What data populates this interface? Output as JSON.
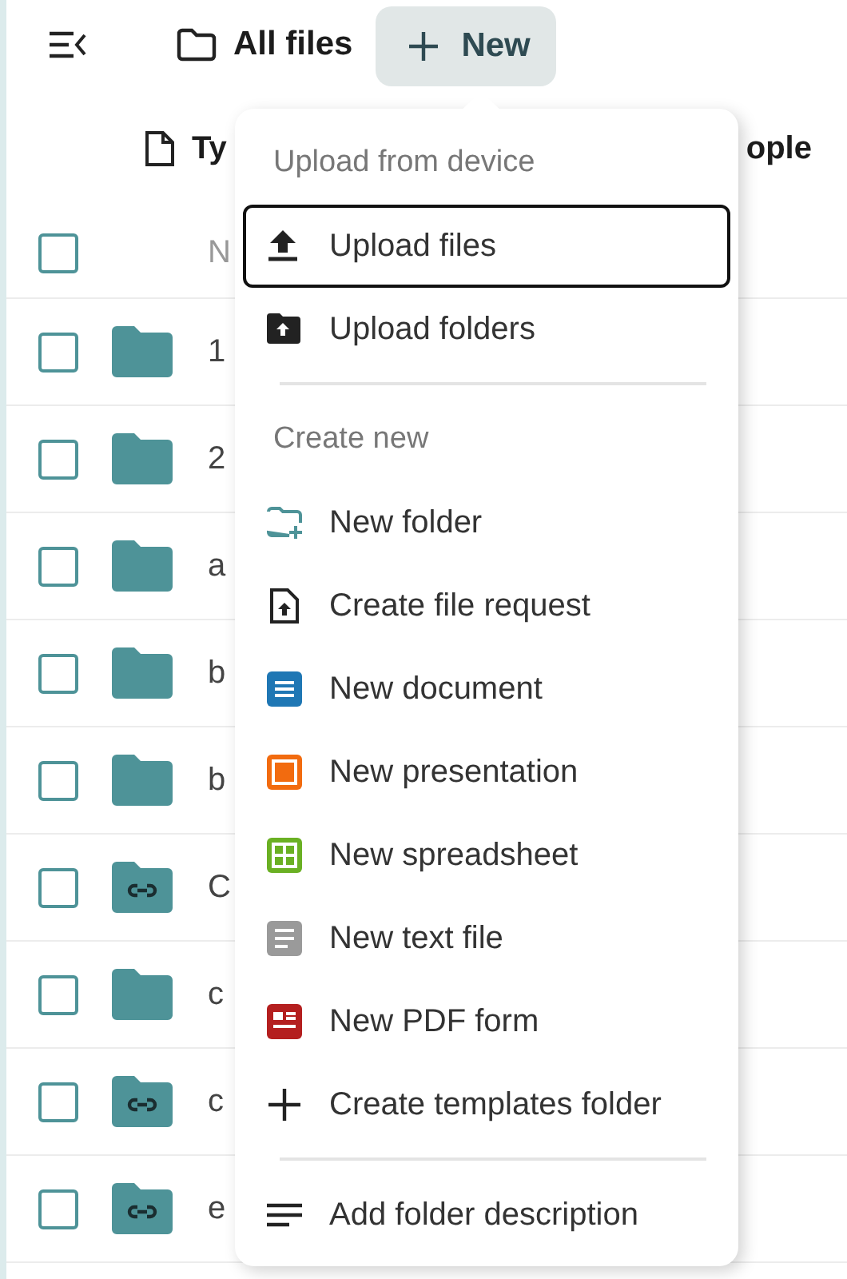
{
  "toolbar": {
    "breadcrumb": "All files",
    "new_button": "New"
  },
  "table": {
    "columns": [
      {
        "label": "Ty"
      },
      {
        "label": "ople"
      }
    ],
    "select_all": {
      "checked": false,
      "label": "N"
    },
    "rows": [
      {
        "kind": "folder",
        "name": "1",
        "checked": false
      },
      {
        "kind": "folder",
        "name": "2",
        "checked": false
      },
      {
        "kind": "folder",
        "name": "a",
        "checked": false
      },
      {
        "kind": "folder",
        "name": "b",
        "checked": false
      },
      {
        "kind": "folder",
        "name": "b",
        "checked": false
      },
      {
        "kind": "shared",
        "name": "C",
        "checked": false
      },
      {
        "kind": "folder",
        "name": "c",
        "checked": false
      },
      {
        "kind": "shared",
        "name": "c",
        "checked": false
      },
      {
        "kind": "shared",
        "name": "e",
        "checked": false
      }
    ]
  },
  "menu": {
    "sections": [
      {
        "heading": "Upload from device",
        "items": [
          {
            "kind": "upload",
            "label": "Upload files",
            "focused": true
          },
          {
            "kind": "upload-folder",
            "label": "Upload folders",
            "focused": false
          }
        ]
      },
      {
        "heading": "Create new",
        "items": [
          {
            "kind": "new-folder",
            "label": "New folder",
            "focused": false
          },
          {
            "kind": "file-request",
            "label": "Create file request",
            "focused": false
          },
          {
            "kind": "document",
            "label": "New document",
            "focused": false
          },
          {
            "kind": "presentation",
            "label": "New presentation",
            "focused": false
          },
          {
            "kind": "spreadsheet",
            "label": "New spreadsheet",
            "focused": false
          },
          {
            "kind": "text",
            "label": "New text file",
            "focused": false
          },
          {
            "kind": "pdf-form",
            "label": "New PDF form",
            "focused": false
          },
          {
            "kind": "plus",
            "label": "Create templates folder",
            "focused": false
          }
        ]
      },
      {
        "items": [
          {
            "kind": "description",
            "label": "Add folder description",
            "focused": false
          }
        ]
      }
    ]
  }
}
